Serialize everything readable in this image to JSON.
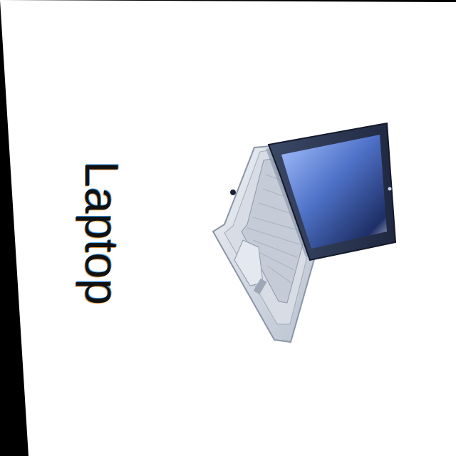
{
  "shortcut": {
    "label": "Laptop",
    "icon": "laptop-icon"
  }
}
